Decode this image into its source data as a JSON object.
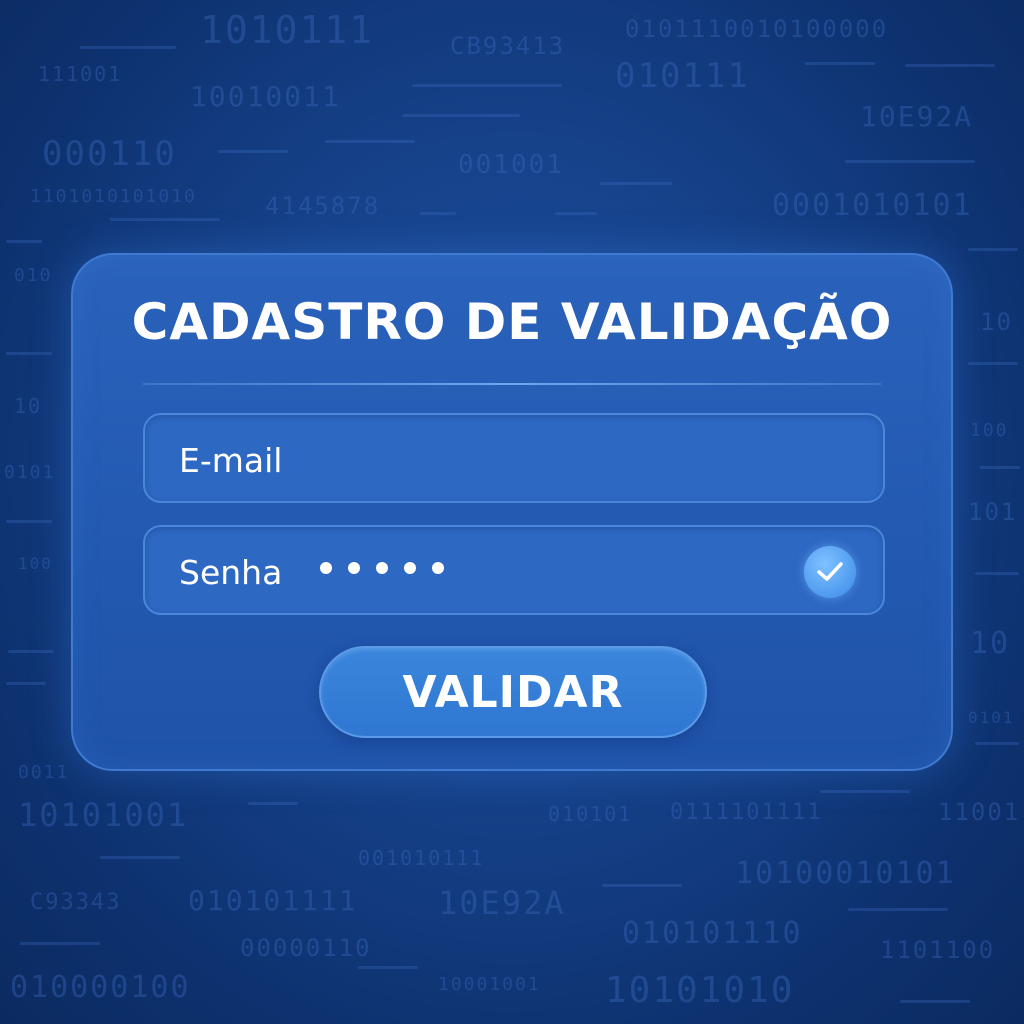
{
  "background": {
    "codes": [
      "1010111",
      "CB93413",
      "0101110010100000",
      "111001",
      "10010011",
      "010111",
      "10E92A",
      "000110",
      "001001",
      "1101010101010",
      "4145878",
      "0001010101",
      "010",
      "10",
      "10",
      "100",
      "0101",
      "101",
      "100",
      "10",
      "0101",
      "0011",
      "10101001",
      "11001",
      "010101",
      "0111101111",
      "001010111",
      "10100010101",
      "C93343",
      "010101111",
      "10E92A",
      "00000110",
      "010101110",
      "1101100",
      "010000100",
      "10001001",
      "10101010"
    ]
  },
  "form": {
    "title": "CADASTRO DE VALIDAÇÃO",
    "email": {
      "label": "E-mail"
    },
    "password": {
      "label": "Senha",
      "masked_length": 5,
      "validated_icon": "check-icon"
    },
    "submit_label": "VALIDAR"
  },
  "colors": {
    "background": "#16428a",
    "card": "#245ab2",
    "field": "#2d68c3",
    "button": "#3580d8",
    "check": "#5aa6f5",
    "text": "#ffffff"
  }
}
